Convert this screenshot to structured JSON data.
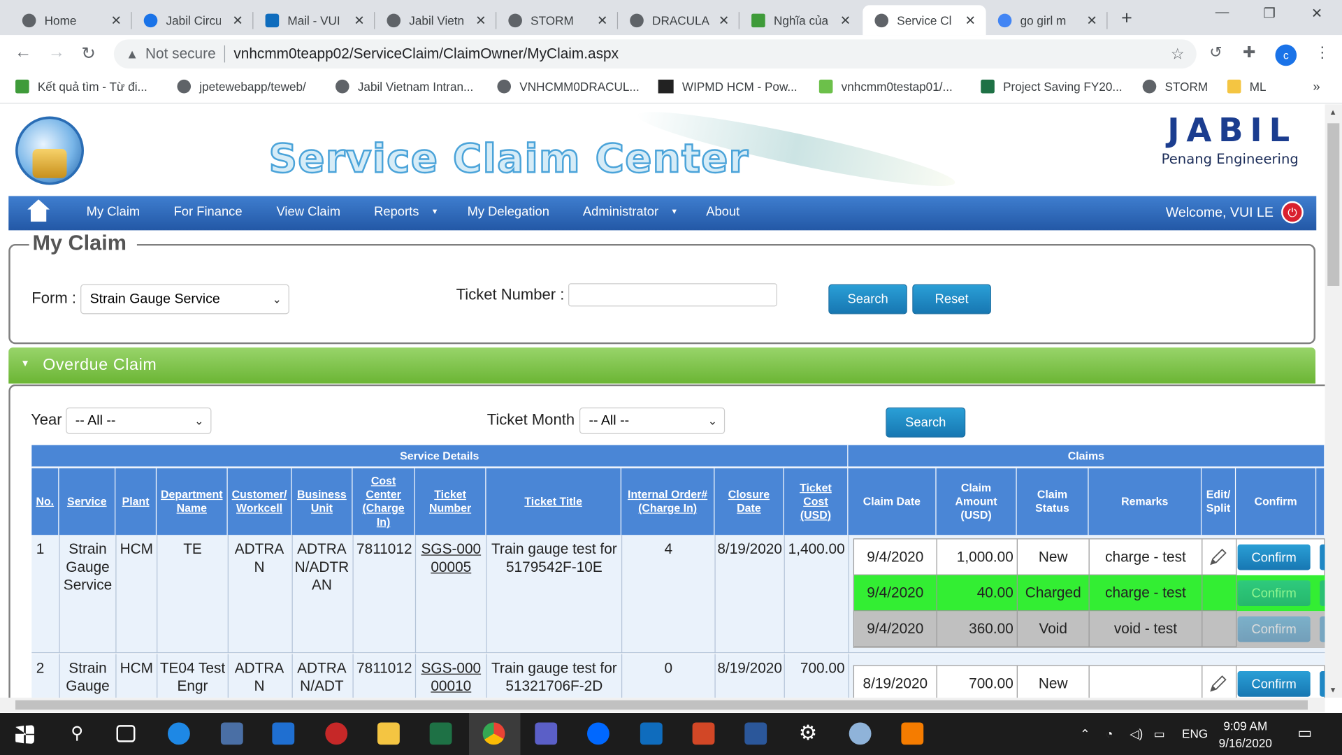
{
  "browser": {
    "tabs": [
      {
        "label": "Home",
        "color": "#5f6368"
      },
      {
        "label": "Jabil Circu",
        "color": "#1a73e8"
      },
      {
        "label": "Mail - VUI",
        "color": "#0f6cbd"
      },
      {
        "label": "Jabil Vietn",
        "color": "#5f6368"
      },
      {
        "label": "STORM",
        "color": "#5f6368"
      },
      {
        "label": "DRACULA",
        "color": "#5f6368"
      },
      {
        "label": "Nghĩa của",
        "color": "#3f9b3a"
      },
      {
        "label": "Service Cl",
        "color": "#5f6368"
      },
      {
        "label": "go girl m",
        "color": "#4285f4"
      }
    ],
    "active_tab": 7,
    "security": "Not secure",
    "url": "vnhcmm0teapp02/ServiceClaim/ClaimOwner/MyClaim.aspx",
    "profile_initial": "c",
    "bookmarks": [
      "Kết quả tìm - Từ đi...",
      "jpetewebapp/teweb/",
      "Jabil Vietnam Intran...",
      "VNHCMM0DRACUL...",
      "WIPMD HCM - Pow...",
      "vnhcmm0testap01/...",
      "Project Saving FY20...",
      "STORM",
      "ML"
    ]
  },
  "header": {
    "title": "Service Claim Center",
    "brand": "JABIL",
    "brand_sub": "Penang Engineering"
  },
  "menu": {
    "items": [
      "My Claim",
      "For Finance",
      "View Claim",
      "Reports",
      "My Delegation",
      "Administrator",
      "About"
    ],
    "welcome": "Welcome, VUI LE"
  },
  "my_claim": {
    "legend": "My Claim",
    "form_label": "Form :",
    "form_value": "Strain Gauge Service",
    "ticket_label": "Ticket Number :",
    "ticket_value": "",
    "search_label": "Search",
    "reset_label": "Reset"
  },
  "overdue": {
    "title": "Overdue Claim",
    "year_label": "Year",
    "year_value": "-- All --",
    "month_label": "Ticket Month",
    "month_value": "-- All --",
    "search_label": "Search"
  },
  "table": {
    "group_service": "Service Details",
    "group_claims": "Claims",
    "headers": {
      "no": "No.",
      "service": "Service",
      "plant": "Plant",
      "dept": "Department Name",
      "customer": "Customer/ Workcell",
      "bu": "Business Unit",
      "cost": "Cost Center (Charge In)",
      "ticket": "Ticket Number",
      "title": "Ticket Title",
      "io": "Internal Order# (Charge In)",
      "closure": "Closure Date",
      "tcost": "Ticket Cost (USD)",
      "cdate": "Claim Date",
      "camount": "Claim Amount (USD)",
      "cstatus": "Claim Status",
      "remarks": "Remarks",
      "edit": "Edit/ Split",
      "confirm": "Confirm"
    },
    "rows": [
      {
        "no": "1",
        "service": "Strain Gauge Service",
        "plant": "HCM",
        "dept": "TE",
        "customer": "ADTRAN",
        "bu": "ADTRAN/ADTRAN",
        "cost": "7811012",
        "ticket": "SGS-00000005",
        "title": "Train gauge test for 5179542F-10E",
        "io": "4",
        "closure": "8/19/2020",
        "tcost": "1,400.00",
        "claims": [
          {
            "date": "9/4/2020",
            "amount": "1,000.00",
            "status": "New",
            "remarks": "charge - test",
            "confirm": "Confirm",
            "bg": "#ffffff"
          },
          {
            "date": "9/4/2020",
            "amount": "40.00",
            "status": "Charged",
            "remarks": "charge - test",
            "confirm": "Confirm",
            "bg": "#33ee33"
          },
          {
            "date": "9/4/2020",
            "amount": "360.00",
            "status": "Void",
            "remarks": "void - test",
            "confirm": "Confirm",
            "bg": "#c0c0c0"
          }
        ]
      },
      {
        "no": "2",
        "service": "Strain Gauge",
        "plant": "HCM",
        "dept": "TE04 Test Engr",
        "customer": "ADTRAN",
        "bu": "ADTRAN/ADT",
        "cost": "7811012",
        "ticket": "SGS-00000010",
        "title": "Train gauge test for 51321706F-2D",
        "io": "0",
        "closure": "8/19/2020",
        "tcost": "700.00",
        "claims": [
          {
            "date": "8/19/2020",
            "amount": "700.00",
            "status": "New",
            "remarks": "",
            "confirm": "Confirm",
            "bg": "#ffffff"
          }
        ]
      }
    ]
  },
  "taskbar": {
    "lang": "ENG",
    "time": "9:09 AM",
    "date": "9/16/2020"
  }
}
